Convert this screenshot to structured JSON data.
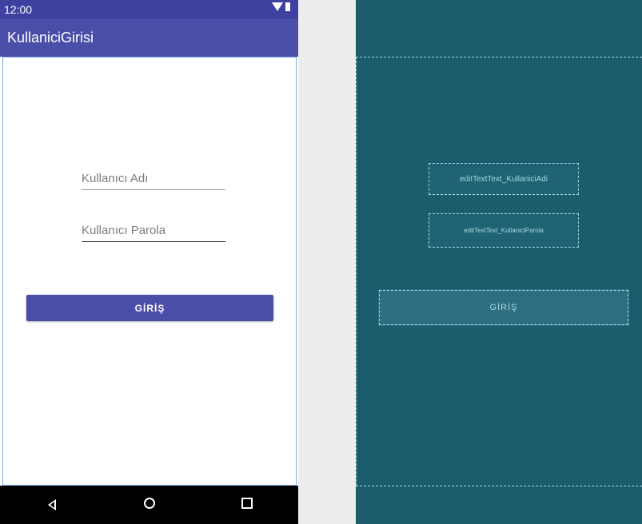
{
  "status_bar": {
    "time": "12:00"
  },
  "app_bar": {
    "title": "KullaniciGirisi"
  },
  "form": {
    "username_hint": "Kullanıcı Adı",
    "password_hint": "Kullanıcı Parola",
    "login_button": "GİRİŞ"
  },
  "blueprint": {
    "username_id": "editTextText_KullaniciAdi",
    "password_id": "editTextText_KullaniciParola",
    "login_button": "GİRİŞ"
  },
  "colors": {
    "primary": "#4b4ea9",
    "primary_dark": "#3f41a0",
    "blueprint_bg": "#1c5c6d",
    "blueprint_line": "#a8d7e2"
  },
  "icons": [
    "wifi-icon",
    "battery-icon",
    "back-icon",
    "home-icon",
    "recent-apps-icon"
  ]
}
